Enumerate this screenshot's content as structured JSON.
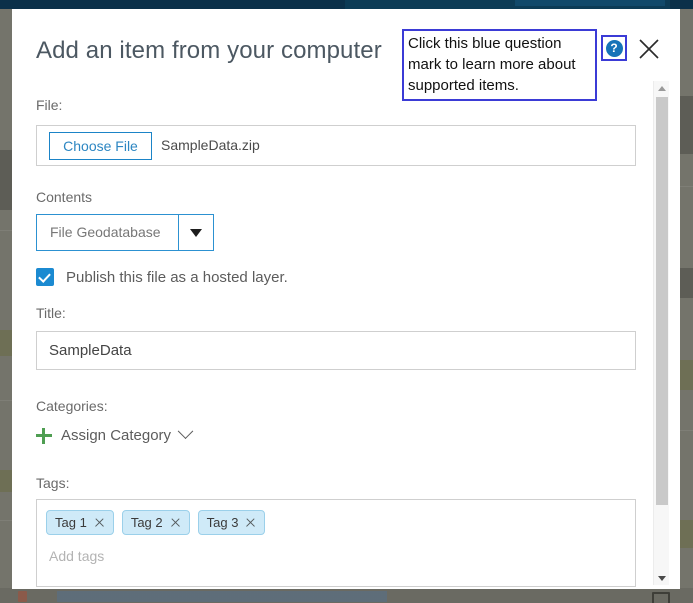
{
  "dialog": {
    "title": "Add an item from your computer",
    "help_icon": "question-mark-icon",
    "help_glyph": "?",
    "close_icon": "close-icon"
  },
  "annotation": {
    "text": "Click this blue question mark to learn more about supported items.",
    "border_color": "#3b3bd6"
  },
  "form": {
    "file": {
      "label": "File:",
      "button_label": "Choose File",
      "file_name": "SampleData.zip"
    },
    "contents": {
      "label": "Contents",
      "selected": "File Geodatabase",
      "options": [
        "File Geodatabase"
      ],
      "dropdown_icon": "chevron-down-icon"
    },
    "publish": {
      "label": "Publish this file as a hosted layer.",
      "checked": true
    },
    "title": {
      "label": "Title:",
      "value": "SampleData"
    },
    "categories": {
      "label": "Categories:",
      "assign_label": "Assign Category",
      "plus_icon": "plus-icon",
      "chevron_icon": "chevron-down-icon"
    },
    "tags": {
      "label": "Tags:",
      "chips": [
        "Tag 1",
        "Tag 2",
        "Tag 3"
      ],
      "placeholder": "Add tags"
    }
  },
  "scrollbar": {
    "up_icon": "caret-up-icon",
    "down_icon": "caret-down-icon"
  },
  "colors": {
    "accent_blue": "#1b8ad1",
    "annotation_blue": "#3b3bd6",
    "title_gray": "#4c5862",
    "chip_blue": "#cfeaf8",
    "plus_green": "#4f9e52",
    "topbar_navy": "#0b3049"
  }
}
